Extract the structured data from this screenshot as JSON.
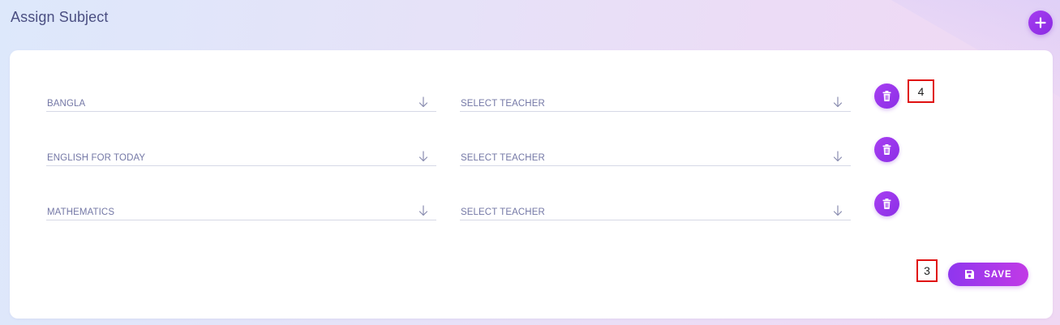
{
  "page": {
    "title": "Assign Subject"
  },
  "rows": [
    {
      "subject": "BANGLA",
      "teacher": "SELECT TEACHER"
    },
    {
      "subject": "ENGLISH FOR TODAY",
      "teacher": "SELECT TEACHER"
    },
    {
      "subject": "MATHEMATICS",
      "teacher": "SELECT TEACHER"
    }
  ],
  "markers": {
    "row_marker": "4",
    "save_marker": "3"
  },
  "actions": {
    "save_label": "SAVE"
  },
  "icons": {
    "add": "plus-icon",
    "delete": "trash-icon",
    "dropdown": "arrow-down-icon",
    "save": "floppy-disk-icon"
  },
  "colors": {
    "accent": "#8b2fe6",
    "accent_end": "#c13ae6",
    "title": "#4b4f82",
    "field_text": "#7478a6",
    "marker_border": "#e01010"
  }
}
